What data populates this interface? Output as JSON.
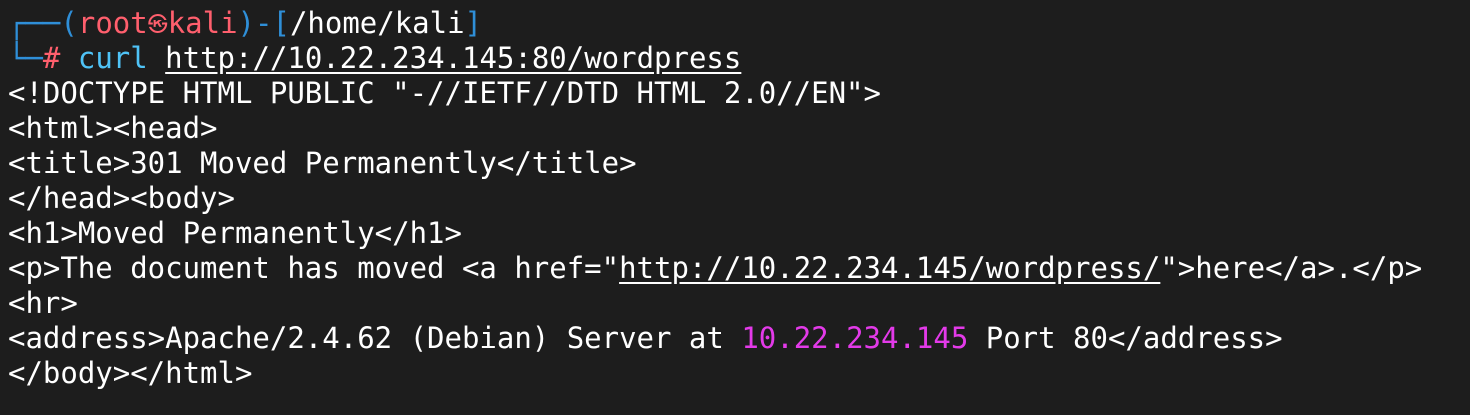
{
  "prompt": {
    "corner_top": "┌──",
    "open_paren": "(",
    "user": "root",
    "symbol": "㉿",
    "host": "kali",
    "close_paren_dash": ")-[",
    "path": "/home/kali",
    "close_bracket": "]",
    "corner_bottom": "└─",
    "hash": "#",
    "command": "curl",
    "url": "http://10.22.234.145:80/wordpress"
  },
  "output": {
    "line1": "<!DOCTYPE HTML PUBLIC \"-//IETF//DTD HTML 2.0//EN\">",
    "line2": "<html><head>",
    "line3": "<title>301 Moved Permanently</title>",
    "line4": "</head><body>",
    "line5": "<h1>Moved Permanently</h1>",
    "line6_prefix": "<p>The document has moved <a href=\"",
    "line6_link": "http://10.22.234.145/wordpress/",
    "line6_suffix": "\">here</a>.</p>",
    "line7": "<hr>",
    "line8_prefix": "<address>Apache/2.4.62 (Debian) Server at ",
    "line8_ip": "10.22.234.145",
    "line8_suffix": " Port 80</address>",
    "line9": "</body></html>"
  },
  "colors": {
    "background": "#1d1d1d",
    "prompt_frame": "#2f8fd8",
    "user_host": "#ff5f6d",
    "command": "#4fc3f7",
    "ip_highlight": "#e33ae9",
    "text": "#ffffff"
  }
}
